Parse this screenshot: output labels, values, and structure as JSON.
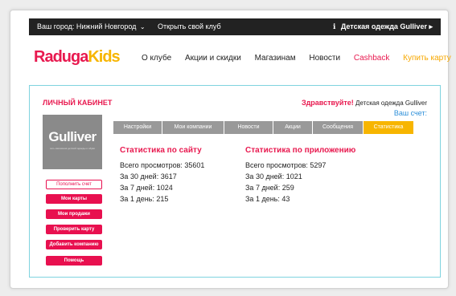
{
  "topbar": {
    "city": "Ваш город: Нижний Новгород",
    "open_club": "Открыть свой клуб",
    "shop_icon": "ℹ",
    "shop": "Детская одежда Gulliver",
    "arrow": "▸"
  },
  "logo": {
    "part1": "Raduga",
    "part2": "Kids"
  },
  "nav": [
    "О клубе",
    "Акции и скидки",
    "Магазинам",
    "Новости",
    "Cashback",
    "Купить карту"
  ],
  "cabinet": {
    "title": "ЛИЧНЫЙ КАБИНЕТ",
    "greeting": "Здравствуйте!",
    "shop_name": "Детская одежда Gulliver",
    "balance_link": "Ваш счет:"
  },
  "avatar": {
    "brand": "Gulliver",
    "tagline": "сеть магазинов детской одежды и обуви"
  },
  "sidebar": {
    "topup": "Пополнить счет",
    "buttons": [
      "Мои карты",
      "Мои продажи",
      "Проверить карту",
      "Добавить компанию",
      "Помощь"
    ]
  },
  "tabs": [
    "Настройки",
    "Мои компании",
    "Новости",
    "Акции",
    "Сообщения",
    "Статистика"
  ],
  "stats": {
    "site": {
      "title": "Статистика по сайту",
      "rows": [
        "Всего просмотров: 35601",
        "За 30 дней: 3617",
        "За 7 дней: 1024",
        "За 1 день: 215"
      ]
    },
    "app": {
      "title": "Статистика по приложению",
      "rows": [
        "Всего просмотров: 5297",
        "За 30 дней: 1021",
        "За 7 дней: 259",
        "За 1 день: 43"
      ]
    }
  },
  "colors": {
    "accent": "#e8194f",
    "yellow": "#f7b500",
    "link": "#2d8fd9",
    "panel_border": "#7fd3df"
  }
}
